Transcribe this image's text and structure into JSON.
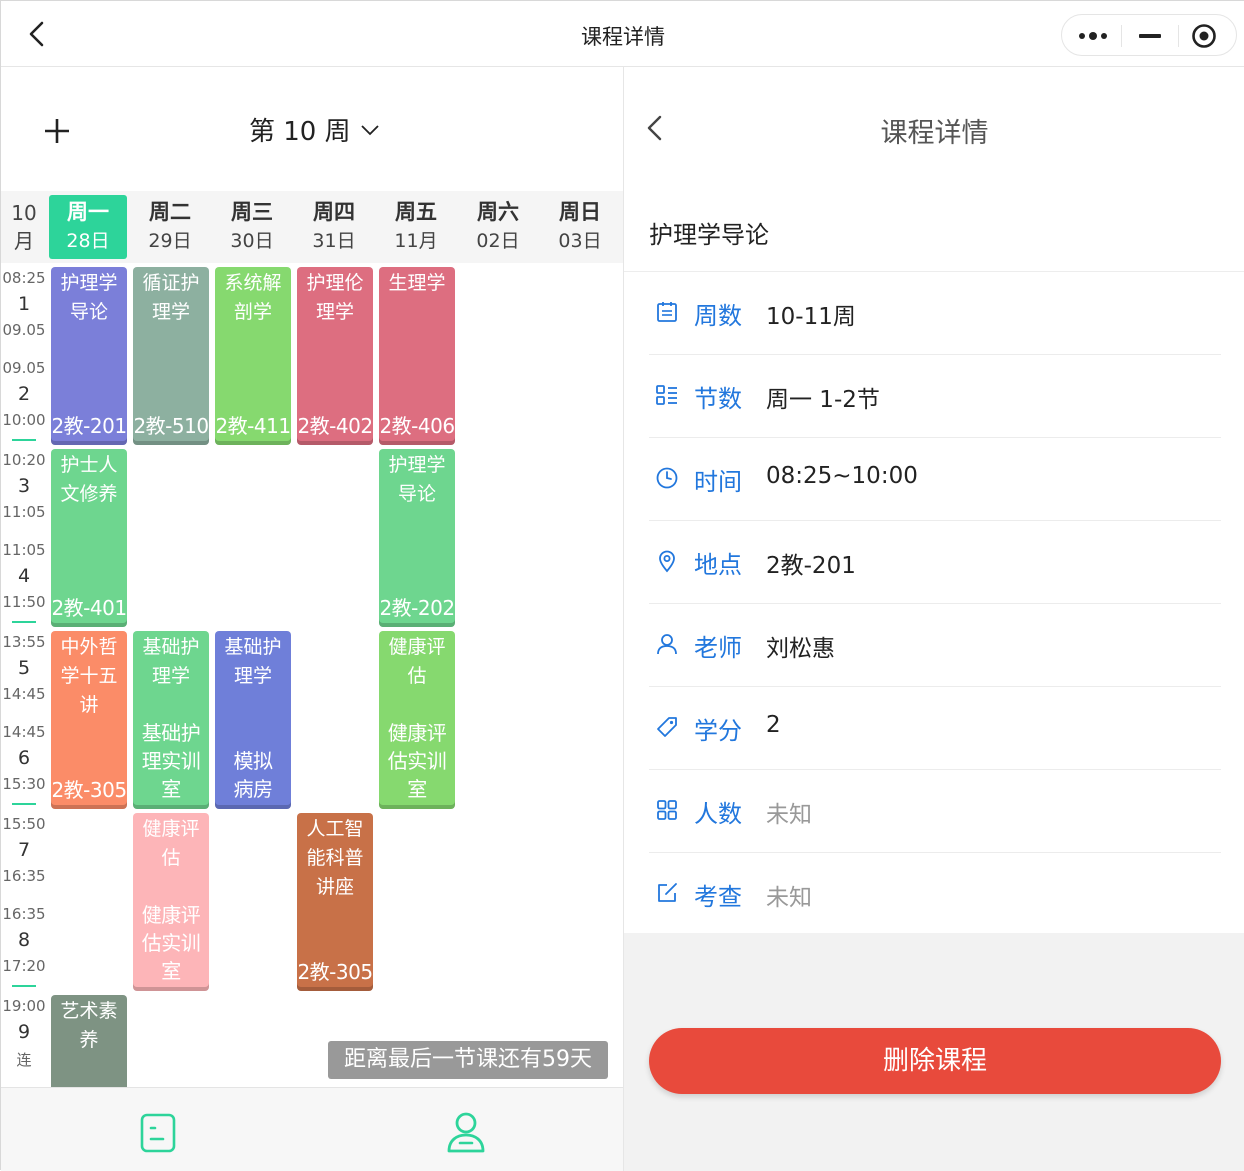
{
  "window": {
    "title": "课程详情"
  },
  "schedule": {
    "week_label": "第 10 周",
    "month": "10",
    "month_unit": "月",
    "days": [
      {
        "name": "周一",
        "date": "28日",
        "active": true
      },
      {
        "name": "周二",
        "date": "29日"
      },
      {
        "name": "周三",
        "date": "30日"
      },
      {
        "name": "周四",
        "date": "31日"
      },
      {
        "name": "周五",
        "date": "11月"
      },
      {
        "name": "周六",
        "date": "02日"
      },
      {
        "name": "周日",
        "date": "03日"
      }
    ],
    "slots": [
      {
        "start": "08:25",
        "num": "1",
        "end": "09.05"
      },
      {
        "start": "09.05",
        "num": "2",
        "end": "10:00"
      },
      {
        "start": "10:20",
        "num": "3",
        "end": "11:05"
      },
      {
        "start": "11:05",
        "num": "4",
        "end": "11:50"
      },
      {
        "start": "13:55",
        "num": "5",
        "end": "14:45"
      },
      {
        "start": "14:45",
        "num": "6",
        "end": "15:30"
      },
      {
        "start": "15:50",
        "num": "7",
        "end": "16:35"
      },
      {
        "start": "16:35",
        "num": "8",
        "end": "17:20"
      },
      {
        "start": "19:00",
        "num": "9",
        "end": "连"
      }
    ],
    "courses": [
      {
        "name": "护理学导论",
        "room": "2教-201",
        "color": "#7b7fd9"
      },
      {
        "name": "循证护理学",
        "room": "2教-510",
        "color": "#8db0a0"
      },
      {
        "name": "系统解剖学",
        "room": "2教-411",
        "color": "#86d96f"
      },
      {
        "name": "护理伦理学",
        "room": "2教-402",
        "color": "#dd6e80"
      },
      {
        "name": "生理学",
        "room": "2教-406",
        "color": "#dd6e80"
      },
      {
        "name": "护士人文修养",
        "room": "2教-401",
        "color": "#6ed68f"
      },
      {
        "name": "护理学导论",
        "room": "2教-202",
        "color": "#6ed68f"
      },
      {
        "name": "中外哲学十五讲",
        "room": "2教-305",
        "color": "#fb8c68"
      },
      {
        "name": "基础护理学",
        "room": "基础护理实训室",
        "color": "#6ed68f"
      },
      {
        "name": "基础护理学",
        "room": "模拟病房",
        "color": "#6f7fd9"
      },
      {
        "name": "健康评估",
        "room": "健康评估实训室",
        "color": "#86d96f"
      },
      {
        "name": "健康评估",
        "room": "健康评估实训室",
        "color": "#fdb5b8"
      },
      {
        "name": "人工智能科普讲座",
        "room": "2教-305",
        "color": "#c87148"
      },
      {
        "name": "艺术素养",
        "room": "",
        "color": "#7e9383"
      }
    ],
    "toast": "距离最后一节课还有59天"
  },
  "detail": {
    "title": "课程详情",
    "course_name": "护理学导论",
    "rows": [
      {
        "icon": "calendar-icon",
        "label": "周数",
        "value": "10-11周",
        "muted": false
      },
      {
        "icon": "list-icon",
        "label": "节数",
        "value": "周一 1-2节",
        "muted": false
      },
      {
        "icon": "clock-icon",
        "label": "时间",
        "value": "08:25~10:00",
        "muted": false
      },
      {
        "icon": "location-icon",
        "label": "地点",
        "value": "2教-201",
        "muted": false
      },
      {
        "icon": "user-icon",
        "label": "老师",
        "value": "刘松惠",
        "muted": false
      },
      {
        "icon": "tag-icon",
        "label": "学分",
        "value": "2",
        "muted": false
      },
      {
        "icon": "grid-icon",
        "label": "人数",
        "value": "未知",
        "muted": true
      },
      {
        "icon": "edit-icon",
        "label": "考查",
        "value": "未知",
        "muted": true
      }
    ],
    "delete_label": "删除课程"
  },
  "colors": {
    "accent": "#2dd49a",
    "link": "#2277dd",
    "danger": "#e84a3c"
  }
}
